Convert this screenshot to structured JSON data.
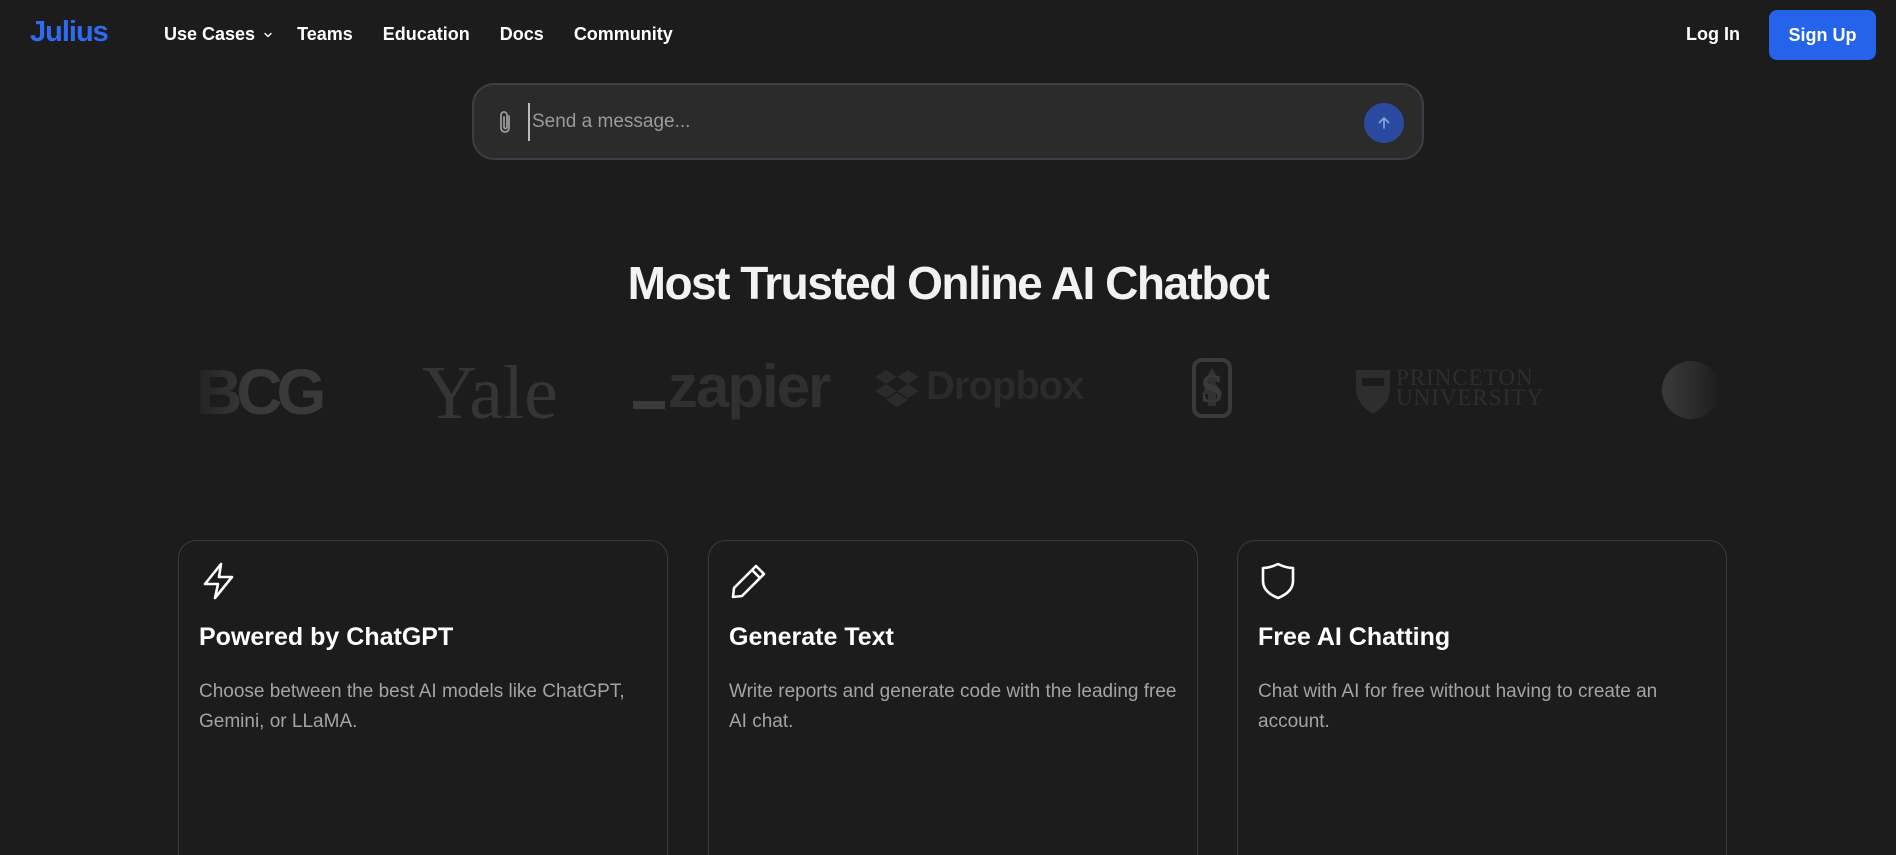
{
  "header": {
    "logo": "Julius",
    "nav": [
      {
        "label": "Use Cases",
        "icon": "chevron-down-icon"
      },
      {
        "label": "Teams"
      },
      {
        "label": "Education"
      },
      {
        "label": "Docs"
      },
      {
        "label": "Community"
      }
    ],
    "login_label": "Log In",
    "signup_label": "Sign Up"
  },
  "composer": {
    "placeholder": "Send a message...",
    "attach_icon": "paperclip-icon",
    "send_icon": "arrow-up-icon"
  },
  "hero": {
    "title": "Most Trusted Online AI Chatbot"
  },
  "logos": {
    "bcg": "BCG",
    "yale": "Yale",
    "zapier": "zapier",
    "dropbox": "Dropbox",
    "stanford": "S",
    "princeton_line1": "PRINCETON",
    "princeton_line2": "UNIVERSITY"
  },
  "features": [
    {
      "icon": "lightning-bolt-icon",
      "title": "Powered by ChatGPT",
      "description": "Choose between the best AI models like ChatGPT, Gemini, or LLaMA."
    },
    {
      "icon": "pencil-icon",
      "title": "Generate Text",
      "description": "Write reports and generate code with the leading free AI chat."
    },
    {
      "icon": "shield-icon",
      "title": "Free AI Chatting",
      "description": "Chat with AI for free without having to create an account."
    }
  ],
  "colors": {
    "background": "#1c1c1c",
    "accent": "#2563eb",
    "logo": "#2f6bf0",
    "muted_text": "#a3a3a3"
  }
}
